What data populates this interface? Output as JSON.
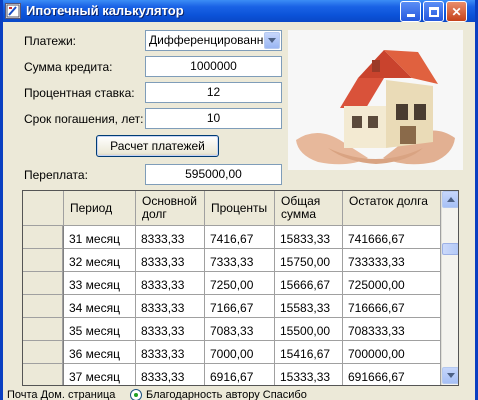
{
  "window": {
    "title": "Ипотечный калькулятор"
  },
  "form": {
    "payments_label": "Платежи:",
    "payments_value": "Дифференцированный",
    "amount_label": "Сумма кредита:",
    "amount_value": "1000000",
    "rate_label": "Процентная ставка:",
    "rate_value": "12",
    "term_label": "Срок погашения, лет:",
    "term_value": "10",
    "calc_button": "Расчет платежей",
    "overpay_label": "Переплата:",
    "overpay_value": "595000,00"
  },
  "table": {
    "headers": [
      "Период",
      "Основной долг",
      "Проценты",
      "Общая сумма",
      "Остаток долга"
    ],
    "rows": [
      [
        "31 месяц",
        "8333,33",
        "7416,67",
        "15833,33",
        "741666,67"
      ],
      [
        "32 месяц",
        "8333,33",
        "7333,33",
        "15750,00",
        "733333,33"
      ],
      [
        "33 месяц",
        "8333,33",
        "7250,00",
        "15666,67",
        "725000,00"
      ],
      [
        "34 месяц",
        "8333,33",
        "7166,67",
        "15583,33",
        "716666,67"
      ],
      [
        "35 месяц",
        "8333,33",
        "7083,33",
        "15500,00",
        "708333,33"
      ],
      [
        "36 месяц",
        "8333,33",
        "7000,00",
        "15416,67",
        "700000,00"
      ],
      [
        "37 месяц",
        "8333,33",
        "6916,67",
        "15333,33",
        "691666,67"
      ]
    ]
  },
  "status": {
    "left_text": "Почта  Дом. страница",
    "right_text": "Благодарность автору  Спасибо"
  },
  "icons": {
    "app": "calculator-icon",
    "house": "house-in-hands-image"
  },
  "colors": {
    "titlebar": "#0b52d8",
    "window_bg": "#ece9d8",
    "grid_bg": "#808080"
  }
}
